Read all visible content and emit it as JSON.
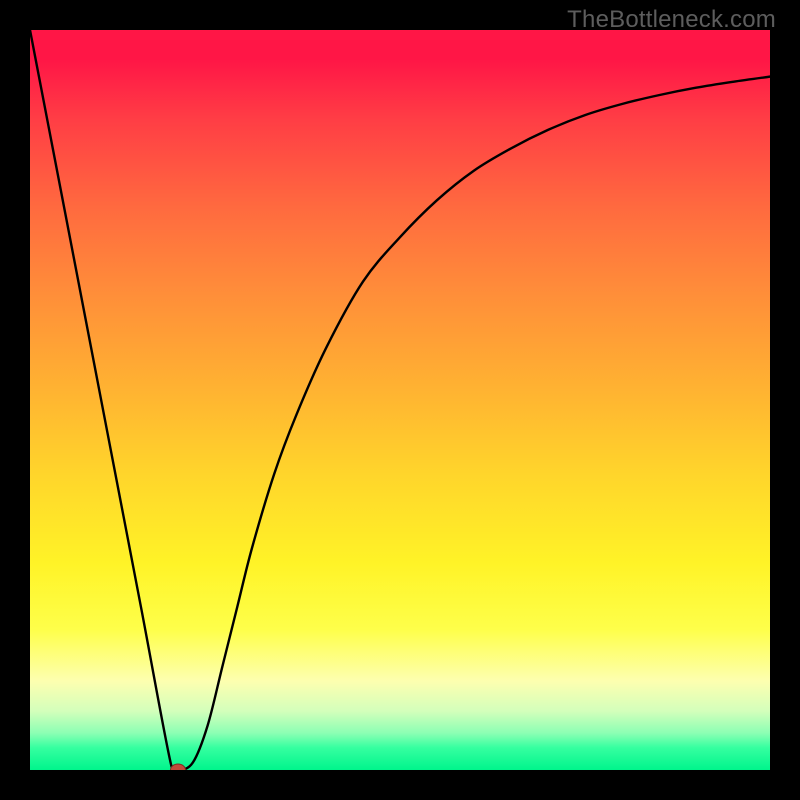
{
  "watermark": "TheBottleneck.com",
  "chart_data": {
    "type": "line",
    "title": "",
    "xlabel": "",
    "ylabel": "",
    "xlim": [
      0,
      100
    ],
    "ylim": [
      0,
      100
    ],
    "x": [
      0,
      5,
      10,
      15,
      19,
      20,
      22,
      24,
      26,
      28,
      30,
      33,
      36,
      40,
      45,
      50,
      55,
      60,
      65,
      70,
      75,
      80,
      85,
      90,
      95,
      100
    ],
    "values": [
      100,
      74,
      48,
      22,
      1,
      0,
      1,
      6,
      14,
      22,
      30,
      40,
      48,
      57,
      66,
      72,
      77,
      81,
      84,
      86.5,
      88.5,
      90,
      91.2,
      92.2,
      93,
      93.7
    ],
    "marker": {
      "x": 20,
      "y": 0,
      "color": "#c24a3a"
    },
    "gradient_stops": [
      {
        "pos": 0.0,
        "color": "#ff1646"
      },
      {
        "pos": 0.24,
        "color": "#ff6a3f"
      },
      {
        "pos": 0.48,
        "color": "#ffb132"
      },
      {
        "pos": 0.72,
        "color": "#fff327"
      },
      {
        "pos": 0.88,
        "color": "#fdffb0"
      },
      {
        "pos": 1.0,
        "color": "#00f58c"
      }
    ]
  }
}
